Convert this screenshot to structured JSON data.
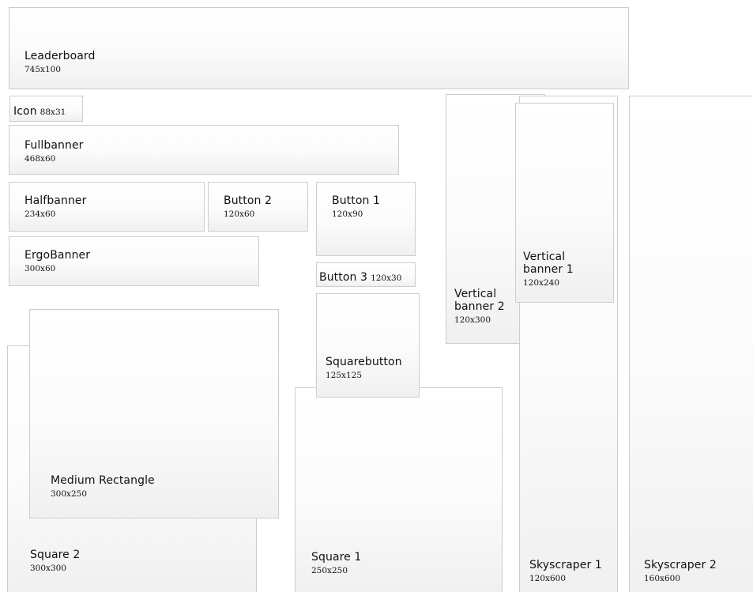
{
  "banners": {
    "leaderboard": {
      "name": "Leaderboard",
      "size": "745x100"
    },
    "icon": {
      "name": "Icon",
      "size": "88x31"
    },
    "fullbanner": {
      "name": "Fullbanner",
      "size": "468x60"
    },
    "halfbanner": {
      "name": "Halfbanner",
      "size": "234x60"
    },
    "button2": {
      "name": "Button 2",
      "size": "120x60"
    },
    "button1": {
      "name": "Button 1",
      "size": "120x90"
    },
    "ergobanner": {
      "name": "ErgoBanner",
      "size": "300x60"
    },
    "button3": {
      "name": "Button 3",
      "size": "120x30"
    },
    "squarebutton": {
      "name": "Squarebutton",
      "size": "125x125"
    },
    "vertical_banner_2": {
      "name_line1": "Vertical",
      "name_line2": "banner 2",
      "size": "120x300"
    },
    "vertical_banner_1": {
      "name_line1": "Vertical",
      "name_line2": "banner 1",
      "size": "120x240"
    },
    "medium_rectangle": {
      "name": "Medium Rectangle",
      "size": "300x250"
    },
    "square2": {
      "name": "Square 2",
      "size": "300x300"
    },
    "square1": {
      "name": "Square 1",
      "size": "250x250"
    },
    "skyscraper1": {
      "name": "Skyscraper 1",
      "size": "120x600"
    },
    "skyscraper2": {
      "name": "Skyscraper 2",
      "size": "160x600"
    }
  }
}
